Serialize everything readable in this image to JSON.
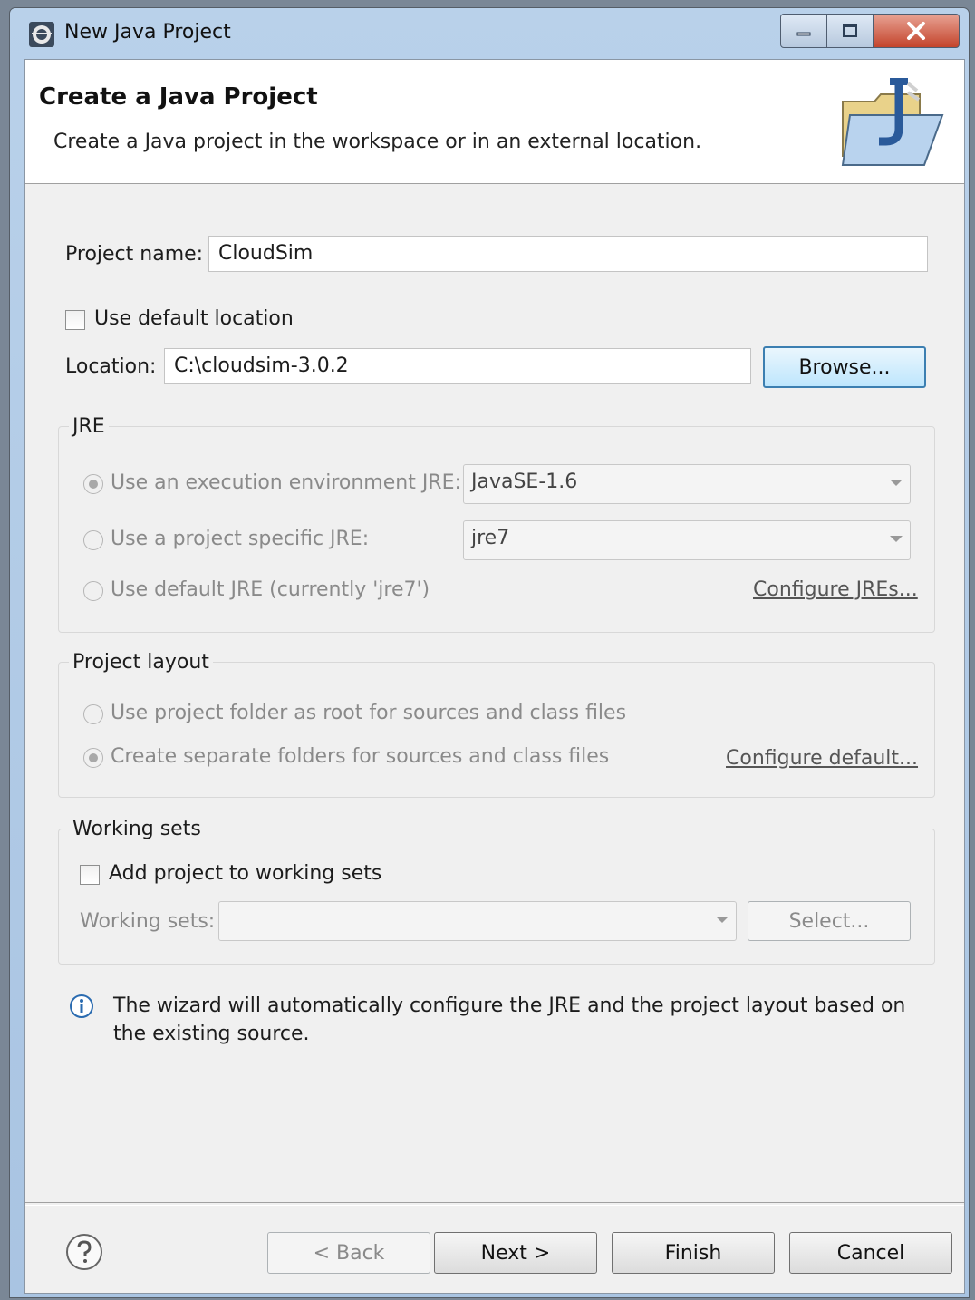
{
  "window": {
    "title": "New Java Project"
  },
  "banner": {
    "title": "Create a Java Project",
    "description": "Create a Java project in the workspace or in an external location."
  },
  "project_name": {
    "label": "Project name:",
    "value": "CloudSim"
  },
  "use_default_location": {
    "label": "Use default location",
    "checked": false
  },
  "location": {
    "label": "Location:",
    "value": "C:\\cloudsim-3.0.2",
    "browse_label": "Browse..."
  },
  "jre": {
    "title": "JRE",
    "option_exec_env": "Use an execution environment JRE:",
    "exec_env_value": "JavaSE-1.6",
    "option_project_specific": "Use a project specific JRE:",
    "project_specific_value": "jre7",
    "option_default": "Use default JRE (currently 'jre7')",
    "configure_link": "Configure JREs..."
  },
  "project_layout": {
    "title": "Project layout",
    "option_root": "Use project folder as root for sources and class files",
    "option_separate": "Create separate folders for sources and class files",
    "configure_link": "Configure default..."
  },
  "working_sets": {
    "title": "Working sets",
    "add_label": "Add project to working sets",
    "sets_label": "Working sets:",
    "sets_value": "",
    "select_label": "Select..."
  },
  "info": {
    "message": "The wizard will automatically configure the JRE and the project layout based on the existing source."
  },
  "footer": {
    "back_label": "< Back",
    "next_label": "Next >",
    "finish_label": "Finish",
    "cancel_label": "Cancel"
  },
  "colors": {
    "accent": "#3c7fb1",
    "info": "#2a6bb0",
    "titlebar": "#b9d1ea",
    "close": "#c4442c"
  }
}
